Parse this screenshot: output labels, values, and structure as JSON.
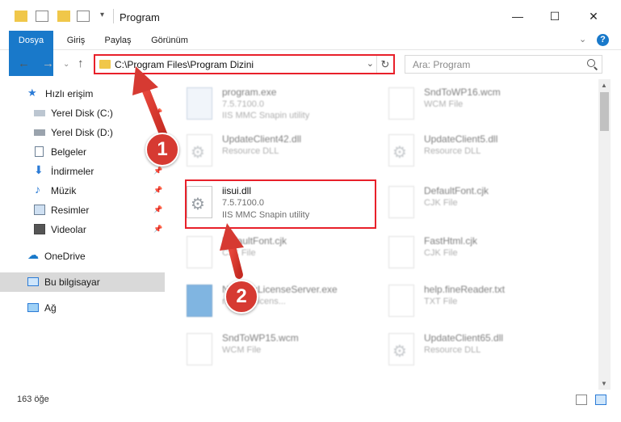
{
  "window": {
    "title": "Program",
    "controls": {
      "minimize": "—",
      "maximize": "☐",
      "close": "✕"
    }
  },
  "ribbon": {
    "tabs": [
      "Dosya",
      "Giriş",
      "Paylaş",
      "Görünüm"
    ],
    "help": "?"
  },
  "address": {
    "path": "C:\\Program Files\\Program Dizini",
    "search_placeholder": "Ara: Program"
  },
  "sidebar": {
    "items": [
      {
        "label": "Hızlı erişim",
        "icon": "star-icon"
      },
      {
        "label": "Yerel Disk (C:)",
        "icon": "drive-icon"
      },
      {
        "label": "Yerel Disk (D:)",
        "icon": "drive-icon"
      },
      {
        "label": "Belgeler",
        "icon": "documents-icon"
      },
      {
        "label": "İndirmeler",
        "icon": "download-icon"
      },
      {
        "label": "Müzik",
        "icon": "music-icon"
      },
      {
        "label": "Resimler",
        "icon": "pictures-icon"
      },
      {
        "label": "Videolar",
        "icon": "video-icon"
      },
      {
        "label": "OneDrive",
        "icon": "cloud-icon"
      },
      {
        "label": "Bu bilgisayar",
        "icon": "computer-icon"
      },
      {
        "label": "Ağ",
        "icon": "network-icon"
      }
    ]
  },
  "files": [
    {
      "name": "program.exe",
      "line2": "7.5.7100.0",
      "line3": "IIS MMC Snapin utility"
    },
    {
      "name": "SndToWP16.wcm",
      "line2": "WCM File",
      "line3": ""
    },
    {
      "name": "UpdateClient42.dll",
      "line2": "Resource DLL",
      "line3": ""
    },
    {
      "name": "UpdateClient5.dll",
      "line2": "Resource DLL",
      "line3": ""
    },
    {
      "name": "iisui.dll",
      "line2": "7.5.7100.0",
      "line3": "IIS MMC Snapin utility"
    },
    {
      "name": "DefaultFont.cjk",
      "line2": "CJK File",
      "line3": ""
    },
    {
      "name": "DefaultFont.cjk",
      "line2": "CJK File",
      "line3": ""
    },
    {
      "name": "FastHtml.cjk",
      "line2": "CJK File",
      "line3": ""
    },
    {
      "name": "NetworkLicenseServer.exe",
      "line2": "network licens...",
      "line3": ""
    },
    {
      "name": "help.fineReader.txt",
      "line2": "TXT File",
      "line3": ""
    },
    {
      "name": "SndToWP15.wcm",
      "line2": "WCM File",
      "line3": ""
    },
    {
      "name": "UpdateClient65.dll",
      "line2": "Resource DLL",
      "line3": ""
    }
  ],
  "status": {
    "item_count": "163 öğe"
  },
  "annotations": {
    "step1": "1",
    "step2": "2"
  },
  "colors": {
    "accent": "#1979ca",
    "highlight": "#e8202a",
    "badge": "#d63a32"
  }
}
